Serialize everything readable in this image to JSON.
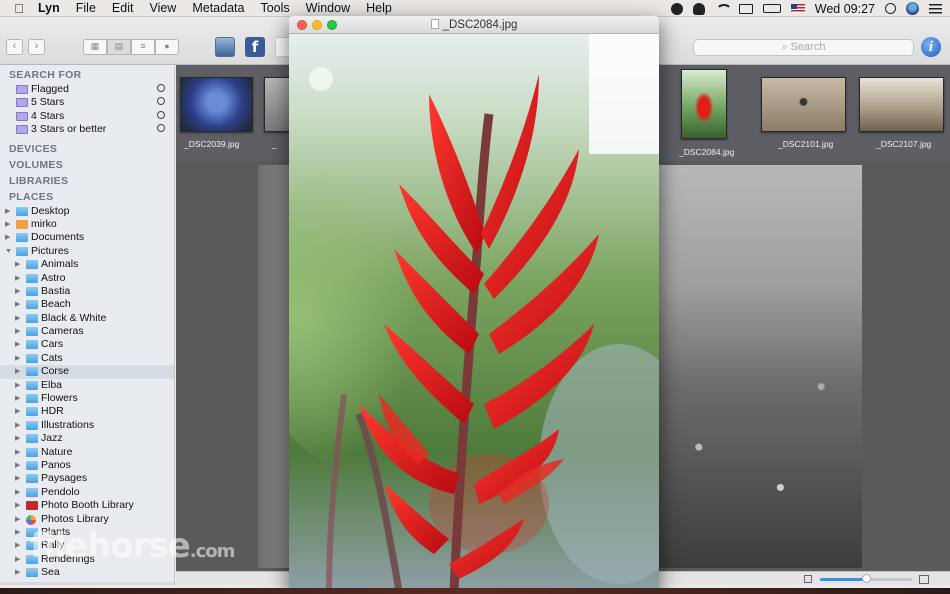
{
  "menubar": {
    "apple": "",
    "app_name": "Lyn",
    "menus": [
      "File",
      "Edit",
      "View",
      "Metadata",
      "Tools",
      "Window",
      "Help"
    ],
    "clock": "Wed 09:27"
  },
  "toolbar": {
    "search_placeholder": "Search",
    "facebook_glyph": "f",
    "info_glyph": "i",
    "back_glyph": "‹",
    "forward_glyph": "›"
  },
  "sidebar": {
    "sections": {
      "search_for": "SEARCH FOR",
      "devices": "DEVICES",
      "volumes": "VOLUMES",
      "libraries": "LIBRARIES",
      "places": "PLACES"
    },
    "searches": [
      "Flagged",
      "5 Stars",
      "4 Stars",
      "3 Stars or better"
    ],
    "places_top": [
      {
        "label": "Desktop",
        "icon": "folder-icon"
      },
      {
        "label": "mirko",
        "icon": "home-icon"
      },
      {
        "label": "Documents",
        "icon": "folder-icon"
      },
      {
        "label": "Pictures",
        "icon": "folder-icon"
      }
    ],
    "pictures_children": [
      {
        "label": "Animals",
        "icon": "folder"
      },
      {
        "label": "Astro",
        "icon": "folder"
      },
      {
        "label": "Bastia",
        "icon": "folder"
      },
      {
        "label": "Beach",
        "icon": "folder"
      },
      {
        "label": "Black & White",
        "icon": "folder"
      },
      {
        "label": "Cameras",
        "icon": "folder"
      },
      {
        "label": "Cars",
        "icon": "folder"
      },
      {
        "label": "Cats",
        "icon": "folder"
      },
      {
        "label": "Corse",
        "icon": "folder"
      },
      {
        "label": "Elba",
        "icon": "folder"
      },
      {
        "label": "Flowers",
        "icon": "folder"
      },
      {
        "label": "HDR",
        "icon": "folder"
      },
      {
        "label": "Illustrations",
        "icon": "folder"
      },
      {
        "label": "Jazz",
        "icon": "folder"
      },
      {
        "label": "Nature",
        "icon": "folder"
      },
      {
        "label": "Panos",
        "icon": "folder"
      },
      {
        "label": "Paysages",
        "icon": "folder"
      },
      {
        "label": "Pendolo",
        "icon": "folder"
      },
      {
        "label": "Photo Booth Library",
        "icon": "photobooth"
      },
      {
        "label": "Photos Library",
        "icon": "photoslib"
      },
      {
        "label": "Plants",
        "icon": "folder"
      },
      {
        "label": "Rally",
        "icon": "folder"
      },
      {
        "label": "Renderings",
        "icon": "folder"
      },
      {
        "label": "Sea",
        "icon": "folder"
      }
    ],
    "selected": "Corse"
  },
  "thumbnails": [
    {
      "caption": "_DSC2039.jpg",
      "tone": "blue-flower"
    },
    {
      "caption": "_",
      "tone": "grey"
    },
    {
      "caption": "_DSC2084.jpg",
      "tone": "red-flower"
    },
    {
      "caption": "_DSC2101.jpg",
      "tone": "spider"
    },
    {
      "caption": "_DSC2107.jpg",
      "tone": "trees"
    }
  ],
  "image_window": {
    "title": "_DSC2084.jpg"
  },
  "zoom": {
    "level": 0.5
  },
  "watermark": {
    "text": "filehorse",
    "suffix": ".com"
  },
  "colors": {
    "accent": "#3a8ee6",
    "flower_red": "#d8141c",
    "sidebar_bg": "#e8ebef"
  }
}
